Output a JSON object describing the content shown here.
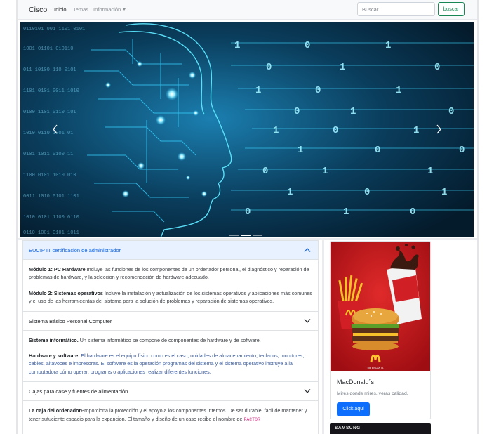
{
  "navbar": {
    "brand": "Cisco",
    "links": [
      {
        "label": "Inicio",
        "active": true
      },
      {
        "label": "Temas",
        "active": false
      },
      {
        "label": "Información",
        "dropdown": true
      }
    ],
    "search_placeholder": "Buscar",
    "search_button": "buscar"
  },
  "carousel": {
    "slide_count": 3,
    "active_slide": 2,
    "prev_icon": "chevron-left-icon",
    "next_icon": "chevron-right-icon"
  },
  "accordion": {
    "items": [
      {
        "title": "EUCIP IT certificación de administrador",
        "open": true,
        "paragraphs": [
          {
            "strong": "Módulo 1: PC Hardware",
            "text": " Incluye las funciones de los componentes de un ordenador personal, el diagnóstico y reparación de problemas de hardware, y la seleccion y recomendación de hardware adecuado."
          },
          {
            "strong": "Módulo 2: Sistemas operativos",
            "text": " Incluye la instalación y actualización de los sistemas operativos y aplicaciones más comunes y el uso de las herramieentas del sistema para la solución de problemas y reparación de sistemas operativos."
          }
        ]
      },
      {
        "title": "Sistema Básico Personal Computer",
        "open": true,
        "paragraphs": [
          {
            "strong": "Sistema informático.",
            "text": " Un sistema informático se compone de componentes de hardware y de software."
          },
          {
            "strong": "Hardware y software.",
            "text": " El hardware es el equipo físico como es el caso, unidades de almacenamiento, teclados, monitores, cables, altavoces e impresoras. El software es la operación programas del sistema y el sistema operativo instruye a la computadora cómo operar, programs o aplicaciones realizar diferentes funciones."
          }
        ]
      },
      {
        "title": "Cajas para case y fuentes de alimentación.",
        "open": true,
        "paragraphs": [
          {
            "strong": "La caja del ordenador",
            "text": "Proporciona la protección y el apoyo a los componentes internos. De ser durable, facil de mantener y tener sufuciente espacio para la expancion. El tamaño y diseño de un caso recibe el nombre de ",
            "code": "FACTOR"
          }
        ]
      }
    ]
  },
  "ad_card": {
    "title": "MacDonald´s",
    "text": "Mires donde mires, veras calidad.",
    "button": "Click aqui",
    "image_caption": "ME ENCANTA"
  },
  "ad_card_2": {
    "brand": "SAMSUNG"
  },
  "colors": {
    "primary": "#0d6efd",
    "success": "#198754",
    "accordion_active_bg": "#e7f1ff",
    "mcd_red": "#c2111a",
    "mcd_yellow": "#ffc72c"
  }
}
